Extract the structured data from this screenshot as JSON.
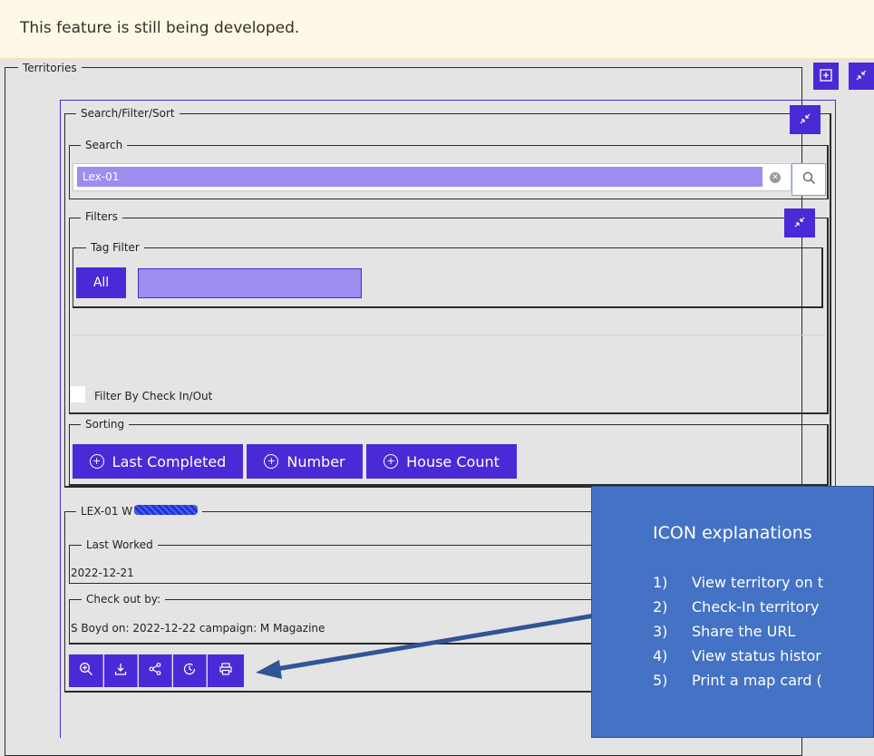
{
  "banner": {
    "text": "This feature is still being developed."
  },
  "territories": {
    "legend": "Territories",
    "add_icon": "plus-square-icon",
    "collapse_icon": "collapse-icon"
  },
  "search_filter_sort": {
    "legend": "Search/Filter/Sort",
    "search": {
      "legend": "Search",
      "value": "Lex-01",
      "clear_icon": "clear-circle-icon",
      "search_icon": "search-icon"
    },
    "filters": {
      "legend": "Filters",
      "tag_filter": {
        "legend": "Tag Filter",
        "all_label": "All",
        "tag_input_value": ""
      },
      "check_in_out_label": "Filter By Check In/Out"
    },
    "sorting": {
      "legend": "Sorting",
      "buttons": [
        "Last Completed",
        "Number",
        "House Count"
      ]
    }
  },
  "territory_card": {
    "legend": "LEX-01 W",
    "last_worked": {
      "legend": "Last Worked",
      "value": "2022-12-21"
    },
    "check_out": {
      "legend": "Check out by:",
      "value": "S Boyd on: 2022-12-22 campaign: M Magazine"
    },
    "icons": [
      "zoom-in-icon",
      "download-icon",
      "share-icon",
      "history-icon",
      "print-icon"
    ]
  },
  "callout": {
    "title": "ICON explanations",
    "items": [
      {
        "num": "1)",
        "text": "View territory on t"
      },
      {
        "num": "2)",
        "text": "Check-In territory"
      },
      {
        "num": "3)",
        "text": "Share the URL"
      },
      {
        "num": "4)",
        "text": "View status histor"
      },
      {
        "num": "5)",
        "text": "Print a map card ("
      }
    ]
  },
  "colors": {
    "accent": "#4a2ad6",
    "input_fill": "#9f8cf0",
    "callout_bg": "#4472c4",
    "banner_bg": "#fdf9e6"
  }
}
